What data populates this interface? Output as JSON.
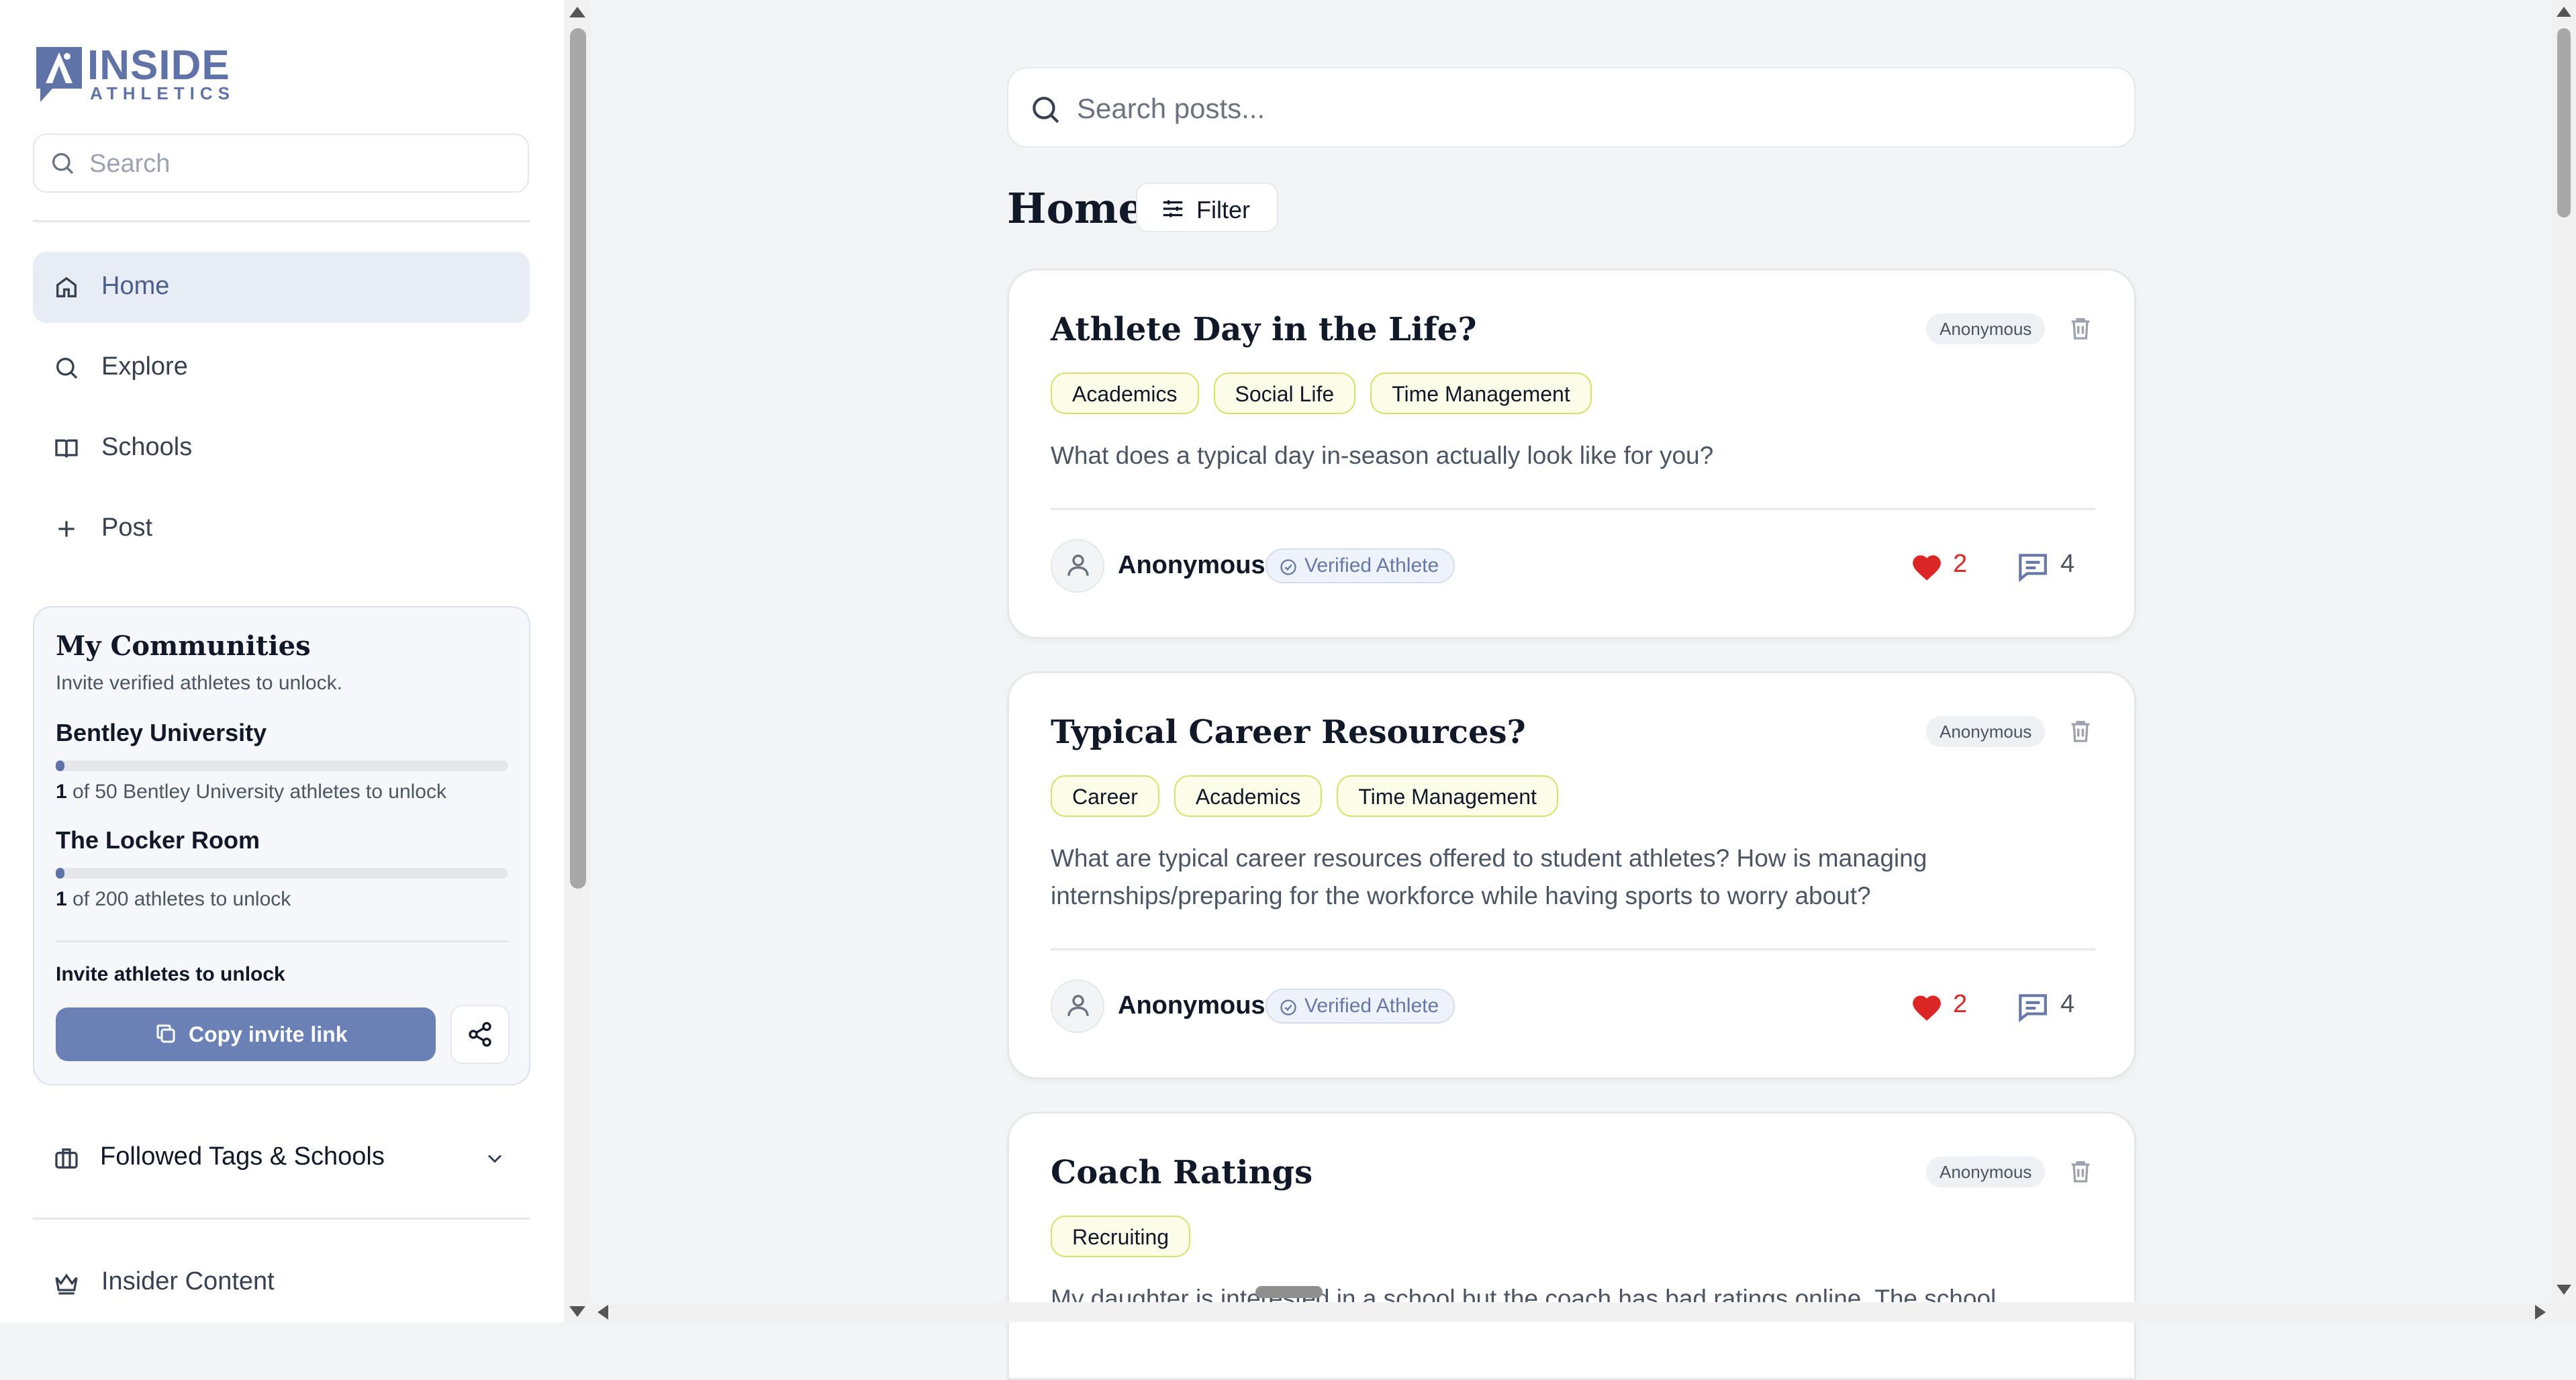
{
  "app": {
    "logo_top": "INSIDE",
    "logo_bottom": "ATHLETICS"
  },
  "sidebar": {
    "search_placeholder": "Search",
    "nav": [
      {
        "label": "Home",
        "icon": "home-icon",
        "active": true
      },
      {
        "label": "Explore",
        "icon": "search-icon"
      },
      {
        "label": "Schools",
        "icon": "book-icon"
      },
      {
        "label": "Post",
        "icon": "plus-icon"
      }
    ],
    "communities": {
      "title": "My Communities",
      "subtitle": "Invite verified athletes to unlock.",
      "items": [
        {
          "name": "Bentley University",
          "count": "1",
          "progress_text": " of 50 Bentley University athletes to unlock",
          "progress": 0.02
        },
        {
          "name": "The Locker Room",
          "count": "1",
          "progress_text": " of 200 athletes to unlock",
          "progress": 0.005
        }
      ],
      "invite_label": "Invite athletes to unlock",
      "copy_button": "Copy invite link"
    },
    "followed_label": "Followed Tags & Schools",
    "insider_label": "Insider Content"
  },
  "main": {
    "search_placeholder": "Search posts...",
    "title": "Home",
    "filter_label": "Filter",
    "posts": [
      {
        "title": "Athlete Day in the Life?",
        "badge": "Anonymous",
        "tags": [
          "Academics",
          "Social Life",
          "Time Management"
        ],
        "body": "What does a typical day in-season actually look like for you?",
        "author": "Anonymous",
        "verified": "Verified Athlete",
        "likes": "2",
        "comments": "4"
      },
      {
        "title": "Typical Career Resources?",
        "badge": "Anonymous",
        "tags": [
          "Career",
          "Academics",
          "Time Management"
        ],
        "body": "What are typical career resources offered to student athletes? How is managing internships/preparing for the workforce while having sports to worry about?",
        "author": "Anonymous",
        "verified": "Verified Athlete",
        "likes": "2",
        "comments": "4"
      },
      {
        "title": "Coach Ratings",
        "badge": "Anonymous",
        "tags": [
          "Recruiting"
        ],
        "body": "My daughter is interested in a school but the coach has bad ratings online. The school",
        "author": "",
        "verified": "",
        "likes": "",
        "comments": ""
      }
    ]
  },
  "colors": {
    "accent": "#6b80b5",
    "active_bg": "#e8ecf5",
    "tag_border": "#d4e26a",
    "like": "#dc2626"
  }
}
